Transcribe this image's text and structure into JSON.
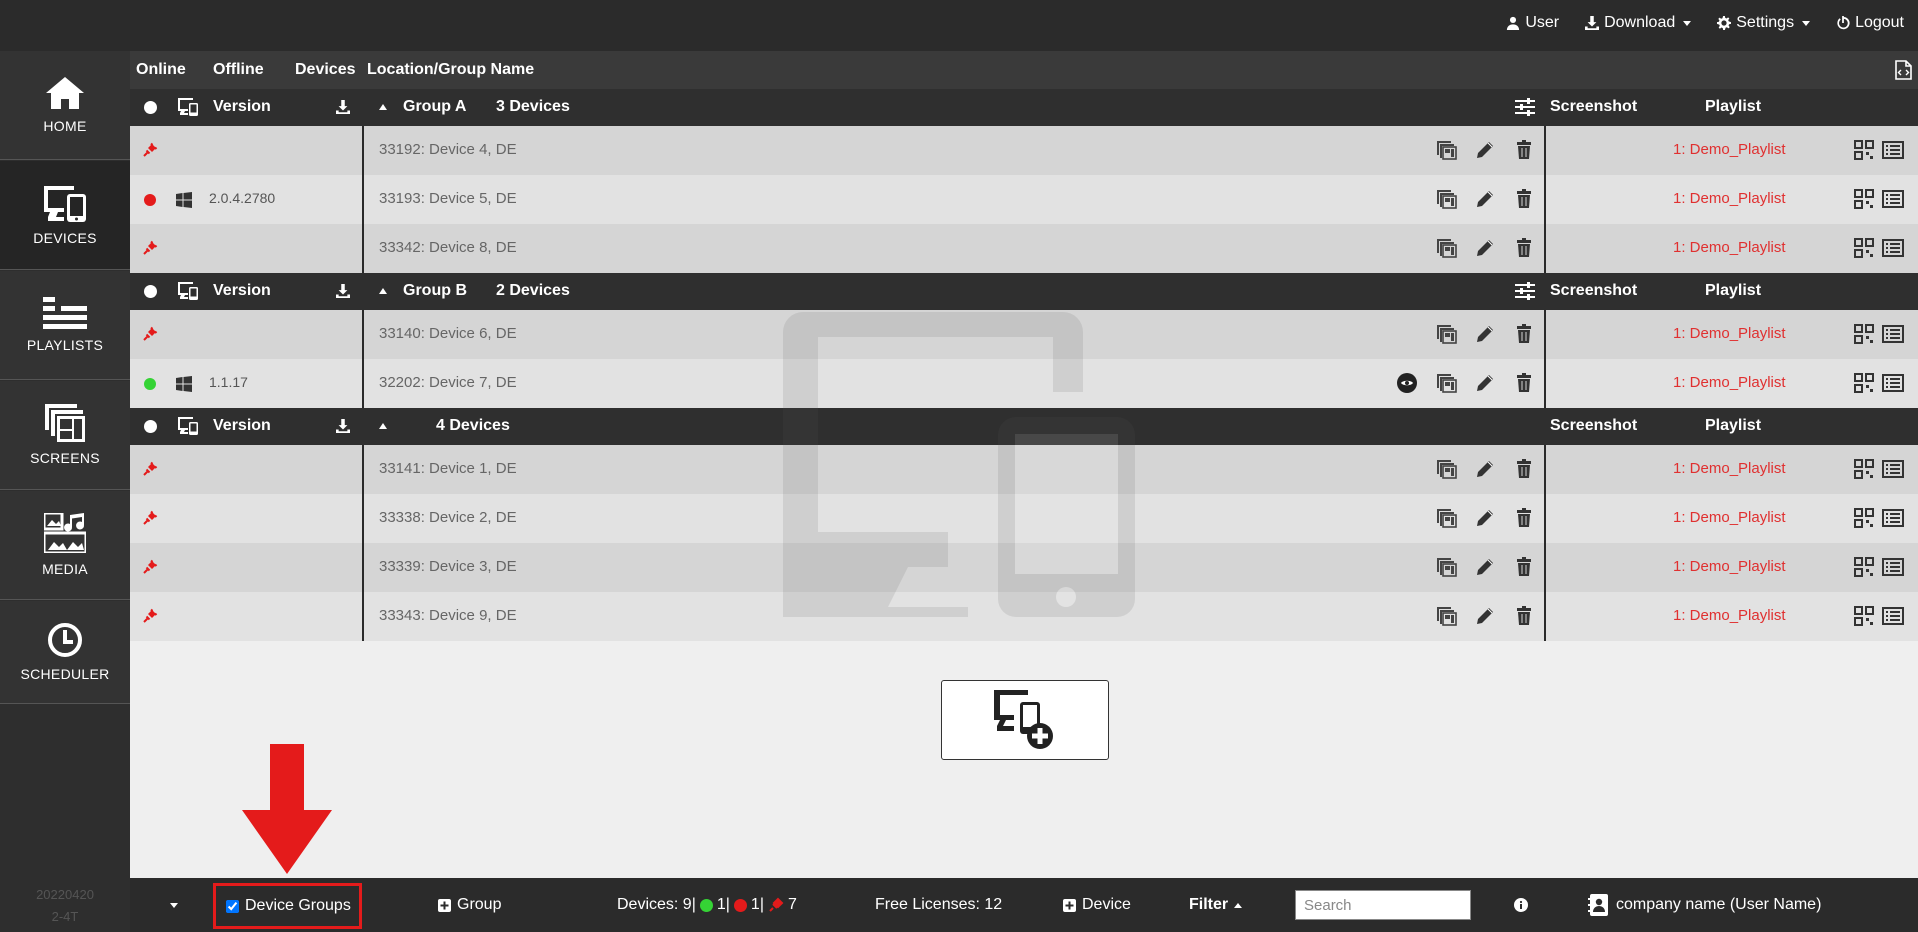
{
  "topmenu": {
    "user": "User",
    "download": "Download",
    "settings": "Settings",
    "logout": "Logout"
  },
  "sidebar": {
    "items": [
      {
        "label": "HOME"
      },
      {
        "label": "DEVICES"
      },
      {
        "label": "PLAYLISTS"
      },
      {
        "label": "SCREENS"
      },
      {
        "label": "MEDIA"
      },
      {
        "label": "SCHEDULER"
      }
    ],
    "version_line1": "20220420",
    "version_line2": "2-4T"
  },
  "columns": {
    "online": "Online",
    "offline": "Offline",
    "devices": "Devices",
    "location": "Location/Group Name"
  },
  "groups": [
    {
      "version_label": "Version",
      "name": "Group A",
      "count": "3 Devices",
      "screenshot_label": "Screenshot",
      "playlist_label": "Playlist",
      "rows": [
        {
          "status": "unplugged",
          "os": "",
          "version": "",
          "device": "33192: Device 4, DE",
          "playlist": "1: Demo_Playlist"
        },
        {
          "status": "offline",
          "os": "windows",
          "version": "2.0.4.2780",
          "device": "33193: Device 5, DE",
          "playlist": "1: Demo_Playlist"
        },
        {
          "status": "unplugged",
          "os": "",
          "version": "",
          "device": "33342: Device 8, DE",
          "playlist": "1: Demo_Playlist"
        }
      ]
    },
    {
      "version_label": "Version",
      "name": "Group B",
      "count": "2 Devices",
      "screenshot_label": "Screenshot",
      "playlist_label": "Playlist",
      "rows": [
        {
          "status": "unplugged",
          "os": "",
          "version": "",
          "device": "33140: Device 6, DE",
          "playlist": "1: Demo_Playlist"
        },
        {
          "status": "online",
          "os": "windows",
          "version": "1.1.17",
          "device": "32202: Device 7, DE",
          "playlist": "1: Demo_Playlist",
          "extra_icon": true
        }
      ]
    },
    {
      "version_label": "Version",
      "name": "",
      "count": "4 Devices",
      "screenshot_label": "Screenshot",
      "playlist_label": "Playlist",
      "rows": [
        {
          "status": "unplugged",
          "os": "",
          "version": "",
          "device": "33141: Device 1, DE",
          "playlist": "1: Demo_Playlist"
        },
        {
          "status": "unplugged",
          "os": "",
          "version": "",
          "device": "33338: Device 2, DE",
          "playlist": "1: Demo_Playlist"
        },
        {
          "status": "unplugged",
          "os": "",
          "version": "",
          "device": "33339: Device 3, DE",
          "playlist": "1: Demo_Playlist"
        },
        {
          "status": "unplugged",
          "os": "",
          "version": "",
          "device": "33343: Device 9, DE",
          "playlist": "1: Demo_Playlist"
        }
      ]
    }
  ],
  "footer": {
    "device_groups_label": "Device Groups",
    "device_groups_checked": true,
    "add_group_label": "Group",
    "devices_prefix": "Devices: 9|",
    "online_count": "1|",
    "offline_count": "1|",
    "unplugged_count": "7",
    "free_licenses": "Free Licenses: 12",
    "add_device_label": "Device",
    "filter_label": "Filter",
    "search_placeholder": "Search",
    "company": "company name (User Name)"
  },
  "colors": {
    "online": "#35d335",
    "offline": "#e41b1b",
    "unplugged": "#e41b1b",
    "playlist": "#e03030",
    "highlight": "#e41b1b"
  }
}
